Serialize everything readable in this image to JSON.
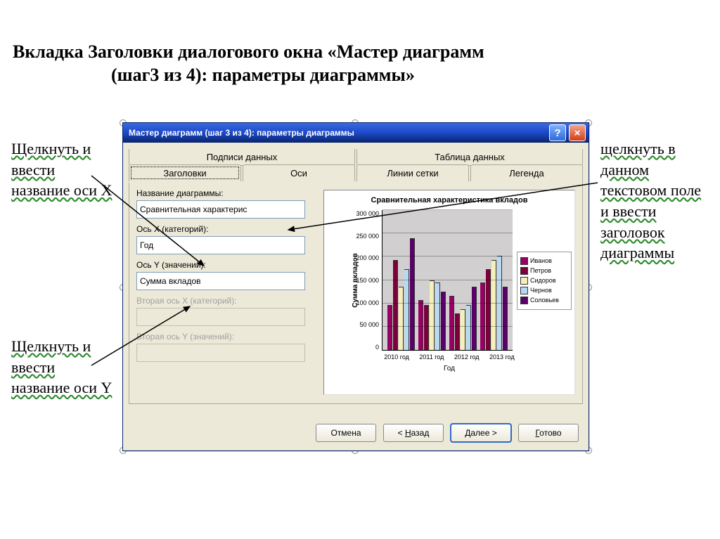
{
  "page_heading_line1": "Вкладка Заголовки диалогового окна «Мастер диаграмм",
  "page_heading_line2": "(шаг3 из 4): параметры диаграммы»",
  "callouts": {
    "top_left": "Щелкнуть и ввести название оси X",
    "bottom_left": "Щелкнуть и ввести название оси Y",
    "right": "щелкнуть в данном текстовом поле и ввести заголовок диаграммы"
  },
  "dialog": {
    "title": "Мастер диаграмм (шаг 3 из 4): параметры диаграммы",
    "tabs": {
      "row1": [
        "Подписи данных",
        "Таблица данных"
      ],
      "row2": [
        "Заголовки",
        "Оси",
        "Линии сетки",
        "Легенда"
      ],
      "active": "Заголовки"
    },
    "form": {
      "chart_title_label": "Название диаграммы:",
      "chart_title_value": "Сравнительная характерис",
      "x_axis_label": "Ось X (категорий):",
      "x_axis_value": "Год",
      "y_axis_label": "Ось Y (значений):",
      "y_axis_value": "Сумма вкладов",
      "x2_label": "Вторая ось X (категорий):",
      "x2_value": "",
      "y2_label": "Вторая ось Y (значений):",
      "y2_value": ""
    },
    "buttons": {
      "cancel": "Отмена",
      "back": "< Назад",
      "next": "Далее >",
      "finish": "Готово"
    }
  },
  "chart_data": {
    "type": "bar",
    "title": "Сравнительная характеристика вкладов",
    "xlabel": "Год",
    "ylabel": "Сумма вкладов",
    "ylim": [
      0,
      300000
    ],
    "categories": [
      "2010 год",
      "2011 год",
      "2012 год",
      "2013 год"
    ],
    "series": [
      {
        "name": "Иванов",
        "color": "#990066",
        "values": [
          100000,
          110000,
          120000,
          150000
        ]
      },
      {
        "name": "Петров",
        "color": "#7c003a",
        "values": [
          200000,
          100000,
          80000,
          180000
        ]
      },
      {
        "name": "Сидоров",
        "color": "#f5f0b8",
        "values": [
          140000,
          155000,
          90000,
          200000
        ]
      },
      {
        "name": "Чернов",
        "color": "#b8d9f0",
        "values": [
          180000,
          150000,
          100000,
          210000
        ]
      },
      {
        "name": "Соловьев",
        "color": "#5b006a",
        "values": [
          250000,
          130000,
          140000,
          140000
        ]
      }
    ],
    "y_ticks": [
      "300 000",
      "250 000",
      "200 000",
      "150 000",
      "100 000",
      "50 000",
      "0"
    ]
  }
}
